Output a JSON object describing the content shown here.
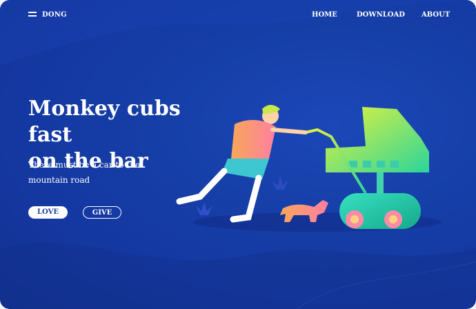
{
  "header": {
    "brand": "DONG",
    "menu": {
      "home": "HOME",
      "download": "DOWNLOAD",
      "about": "ABOUT"
    }
  },
  "hero": {
    "title_line1": "Monkey cubs fast",
    "title_line2": "on the bar",
    "subtitle_line1": "There must be a car to the",
    "subtitle_line2": "mountain road",
    "buttons": {
      "love": "LOVE",
      "give": "GIVE"
    }
  },
  "icons": {
    "menu": "hamburger-icon"
  },
  "colors": {
    "background": "#1437a0",
    "text": "#ffffff",
    "button_text": "#1a3f9f"
  }
}
